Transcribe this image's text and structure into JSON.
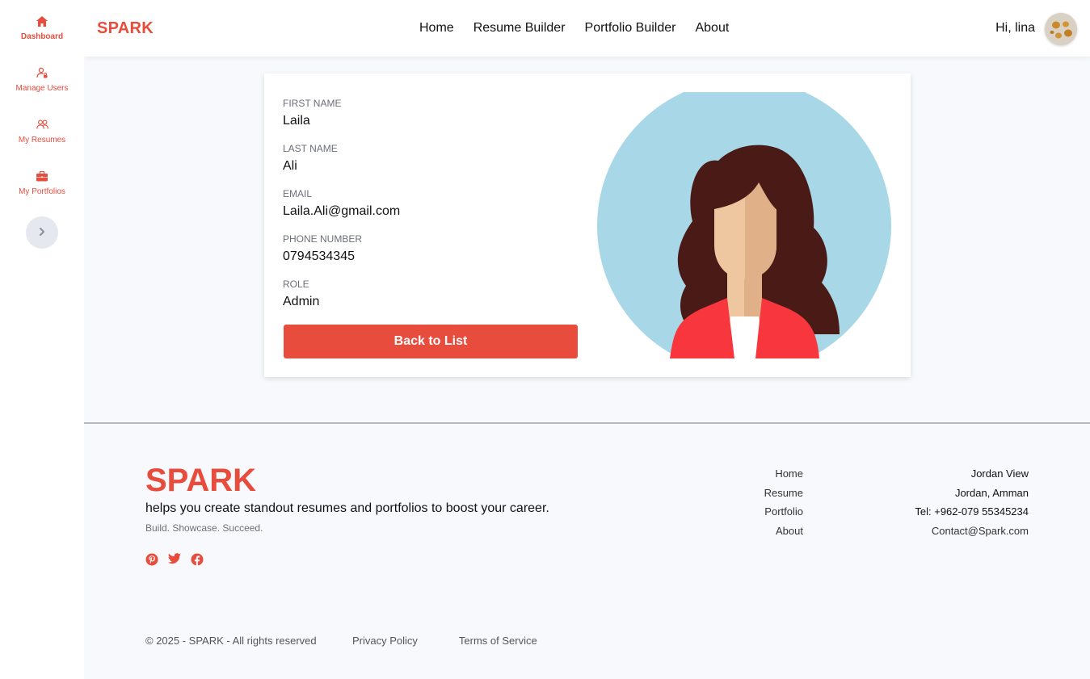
{
  "sidebar": {
    "items": [
      {
        "label": "Dashboard",
        "icon": "home-icon"
      },
      {
        "label": "Manage Users",
        "icon": "user-lock-icon"
      },
      {
        "label": "My Resumes",
        "icon": "users-icon"
      },
      {
        "label": "My Portfolios",
        "icon": "briefcase-icon"
      }
    ],
    "toggle_icon": "chevron-right-icon"
  },
  "header": {
    "brand": "SPARK",
    "nav": [
      "Home",
      "Resume Builder",
      "Portfolio Builder",
      "About"
    ],
    "greeting": "Hi, lina"
  },
  "profile": {
    "fields": [
      {
        "label": "FIRST NAME",
        "value": "Laila"
      },
      {
        "label": "LAST NAME",
        "value": "Ali"
      },
      {
        "label": "EMAIL",
        "value": "Laila.Ali@gmail.com"
      },
      {
        "label": "PHONE NUMBER",
        "value": "0794534345"
      },
      {
        "label": "ROLE",
        "value": "Admin"
      }
    ],
    "back_label": "Back to List"
  },
  "footer": {
    "brand": "SPARK",
    "tagline": "helps you create standout resumes and portfolios to boost your career.",
    "subtag": "Build. Showcase. Succeed.",
    "social": [
      "pinterest-icon",
      "twitter-icon",
      "facebook-icon"
    ],
    "links": [
      "Home",
      "Resume",
      "Portfolio",
      "About"
    ],
    "contact": {
      "line1": "Jordan View",
      "line2": "Jordan, Amman",
      "phone": "Tel: +962-079 55345234",
      "email": "Contact@Spark.com"
    },
    "copyright": "© 2025 - SPARK - All rights reserved",
    "privacy": "Privacy Policy",
    "terms": "Terms of Service"
  },
  "colors": {
    "accent": "#e74c3c",
    "background": "#f8f9fc",
    "portrait_bg": "#a8d8e8"
  }
}
